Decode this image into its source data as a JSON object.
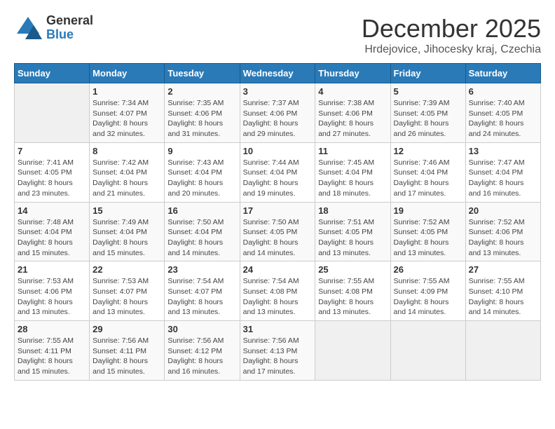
{
  "logo": {
    "general": "General",
    "blue": "Blue"
  },
  "title": {
    "month": "December 2025",
    "location": "Hrdejovice, Jihocesky kraj, Czechia"
  },
  "calendar": {
    "headers": [
      "Sunday",
      "Monday",
      "Tuesday",
      "Wednesday",
      "Thursday",
      "Friday",
      "Saturday"
    ],
    "weeks": [
      [
        {
          "day": "",
          "sunrise": "",
          "sunset": "",
          "daylight": ""
        },
        {
          "day": "1",
          "sunrise": "Sunrise: 7:34 AM",
          "sunset": "Sunset: 4:07 PM",
          "daylight": "Daylight: 8 hours and 32 minutes."
        },
        {
          "day": "2",
          "sunrise": "Sunrise: 7:35 AM",
          "sunset": "Sunset: 4:06 PM",
          "daylight": "Daylight: 8 hours and 31 minutes."
        },
        {
          "day": "3",
          "sunrise": "Sunrise: 7:37 AM",
          "sunset": "Sunset: 4:06 PM",
          "daylight": "Daylight: 8 hours and 29 minutes."
        },
        {
          "day": "4",
          "sunrise": "Sunrise: 7:38 AM",
          "sunset": "Sunset: 4:06 PM",
          "daylight": "Daylight: 8 hours and 27 minutes."
        },
        {
          "day": "5",
          "sunrise": "Sunrise: 7:39 AM",
          "sunset": "Sunset: 4:05 PM",
          "daylight": "Daylight: 8 hours and 26 minutes."
        },
        {
          "day": "6",
          "sunrise": "Sunrise: 7:40 AM",
          "sunset": "Sunset: 4:05 PM",
          "daylight": "Daylight: 8 hours and 24 minutes."
        }
      ],
      [
        {
          "day": "7",
          "sunrise": "Sunrise: 7:41 AM",
          "sunset": "Sunset: 4:05 PM",
          "daylight": "Daylight: 8 hours and 23 minutes."
        },
        {
          "day": "8",
          "sunrise": "Sunrise: 7:42 AM",
          "sunset": "Sunset: 4:04 PM",
          "daylight": "Daylight: 8 hours and 21 minutes."
        },
        {
          "day": "9",
          "sunrise": "Sunrise: 7:43 AM",
          "sunset": "Sunset: 4:04 PM",
          "daylight": "Daylight: 8 hours and 20 minutes."
        },
        {
          "day": "10",
          "sunrise": "Sunrise: 7:44 AM",
          "sunset": "Sunset: 4:04 PM",
          "daylight": "Daylight: 8 hours and 19 minutes."
        },
        {
          "day": "11",
          "sunrise": "Sunrise: 7:45 AM",
          "sunset": "Sunset: 4:04 PM",
          "daylight": "Daylight: 8 hours and 18 minutes."
        },
        {
          "day": "12",
          "sunrise": "Sunrise: 7:46 AM",
          "sunset": "Sunset: 4:04 PM",
          "daylight": "Daylight: 8 hours and 17 minutes."
        },
        {
          "day": "13",
          "sunrise": "Sunrise: 7:47 AM",
          "sunset": "Sunset: 4:04 PM",
          "daylight": "Daylight: 8 hours and 16 minutes."
        }
      ],
      [
        {
          "day": "14",
          "sunrise": "Sunrise: 7:48 AM",
          "sunset": "Sunset: 4:04 PM",
          "daylight": "Daylight: 8 hours and 15 minutes."
        },
        {
          "day": "15",
          "sunrise": "Sunrise: 7:49 AM",
          "sunset": "Sunset: 4:04 PM",
          "daylight": "Daylight: 8 hours and 15 minutes."
        },
        {
          "day": "16",
          "sunrise": "Sunrise: 7:50 AM",
          "sunset": "Sunset: 4:04 PM",
          "daylight": "Daylight: 8 hours and 14 minutes."
        },
        {
          "day": "17",
          "sunrise": "Sunrise: 7:50 AM",
          "sunset": "Sunset: 4:05 PM",
          "daylight": "Daylight: 8 hours and 14 minutes."
        },
        {
          "day": "18",
          "sunrise": "Sunrise: 7:51 AM",
          "sunset": "Sunset: 4:05 PM",
          "daylight": "Daylight: 8 hours and 13 minutes."
        },
        {
          "day": "19",
          "sunrise": "Sunrise: 7:52 AM",
          "sunset": "Sunset: 4:05 PM",
          "daylight": "Daylight: 8 hours and 13 minutes."
        },
        {
          "day": "20",
          "sunrise": "Sunrise: 7:52 AM",
          "sunset": "Sunset: 4:06 PM",
          "daylight": "Daylight: 8 hours and 13 minutes."
        }
      ],
      [
        {
          "day": "21",
          "sunrise": "Sunrise: 7:53 AM",
          "sunset": "Sunset: 4:06 PM",
          "daylight": "Daylight: 8 hours and 13 minutes."
        },
        {
          "day": "22",
          "sunrise": "Sunrise: 7:53 AM",
          "sunset": "Sunset: 4:07 PM",
          "daylight": "Daylight: 8 hours and 13 minutes."
        },
        {
          "day": "23",
          "sunrise": "Sunrise: 7:54 AM",
          "sunset": "Sunset: 4:07 PM",
          "daylight": "Daylight: 8 hours and 13 minutes."
        },
        {
          "day": "24",
          "sunrise": "Sunrise: 7:54 AM",
          "sunset": "Sunset: 4:08 PM",
          "daylight": "Daylight: 8 hours and 13 minutes."
        },
        {
          "day": "25",
          "sunrise": "Sunrise: 7:55 AM",
          "sunset": "Sunset: 4:08 PM",
          "daylight": "Daylight: 8 hours and 13 minutes."
        },
        {
          "day": "26",
          "sunrise": "Sunrise: 7:55 AM",
          "sunset": "Sunset: 4:09 PM",
          "daylight": "Daylight: 8 hours and 14 minutes."
        },
        {
          "day": "27",
          "sunrise": "Sunrise: 7:55 AM",
          "sunset": "Sunset: 4:10 PM",
          "daylight": "Daylight: 8 hours and 14 minutes."
        }
      ],
      [
        {
          "day": "28",
          "sunrise": "Sunrise: 7:55 AM",
          "sunset": "Sunset: 4:11 PM",
          "daylight": "Daylight: 8 hours and 15 minutes."
        },
        {
          "day": "29",
          "sunrise": "Sunrise: 7:56 AM",
          "sunset": "Sunset: 4:11 PM",
          "daylight": "Daylight: 8 hours and 15 minutes."
        },
        {
          "day": "30",
          "sunrise": "Sunrise: 7:56 AM",
          "sunset": "Sunset: 4:12 PM",
          "daylight": "Daylight: 8 hours and 16 minutes."
        },
        {
          "day": "31",
          "sunrise": "Sunrise: 7:56 AM",
          "sunset": "Sunset: 4:13 PM",
          "daylight": "Daylight: 8 hours and 17 minutes."
        },
        {
          "day": "",
          "sunrise": "",
          "sunset": "",
          "daylight": ""
        },
        {
          "day": "",
          "sunrise": "",
          "sunset": "",
          "daylight": ""
        },
        {
          "day": "",
          "sunrise": "",
          "sunset": "",
          "daylight": ""
        }
      ]
    ]
  }
}
